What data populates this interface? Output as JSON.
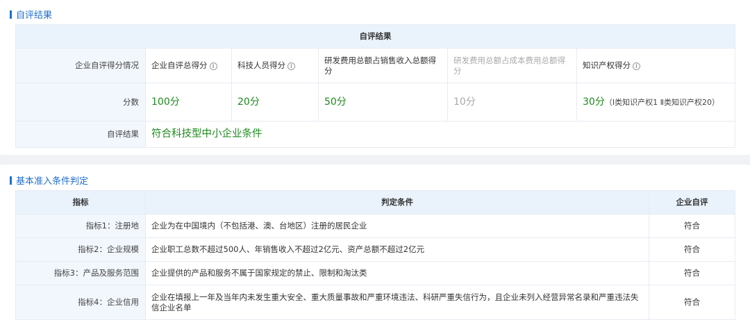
{
  "section1": {
    "title": "自评结果",
    "table_title": "自评结果",
    "row_header_label": "企业自评得分情况",
    "columns": [
      {
        "label": "企业自评总得分",
        "has_info": true
      },
      {
        "label": "科技人员得分",
        "has_info": true
      },
      {
        "label": "研发费用总额占销售收入总额得分",
        "has_info": false
      },
      {
        "label": "研发费用总额占成本费用总额得分",
        "has_info": false
      },
      {
        "label": "知识产权得分",
        "has_info": true
      }
    ],
    "score_label": "分数",
    "scores": [
      "100分",
      "20分",
      "50分",
      "10分",
      "30分"
    ],
    "ip_note": "（Ⅰ类知识产权1 Ⅱ类知识产权20）",
    "result_label": "自评结果",
    "result_value": "符合科技型中小企业条件"
  },
  "section2": {
    "title": "基本准入条件判定",
    "headers": [
      "指标",
      "判定条件",
      "企业自评"
    ],
    "rows": [
      {
        "indicator": "指标1：注册地",
        "condition": "企业为在中国境内（不包括港、澳、台地区）注册的居民企业",
        "self_eval": "符合"
      },
      {
        "indicator": "指标2：企业规模",
        "condition": "企业职工总数不超过500人、年销售收入不超过2亿元、资产总额不超过2亿元",
        "self_eval": "符合"
      },
      {
        "indicator": "指标3：产品及服务范围",
        "condition": "企业提供的产品和服务不属于国家规定的禁止、限制和淘汰类",
        "self_eval": "符合"
      },
      {
        "indicator": "指标4：企业信用",
        "condition": "企业在填报上一年及当年内未发生重大安全、重大质量事故和严重环境违法、科研严重失信行为，且企业未列入经营异常名录和严重违法失信企业名单",
        "self_eval": "符合"
      }
    ]
  },
  "colors": {
    "accent": "#1f6fd0",
    "score_green": "#1d8a1d",
    "disabled_grey": "#aaaaaa",
    "header_bg": "#eaf3fc"
  },
  "icons": {
    "info": "info-circle-icon"
  }
}
